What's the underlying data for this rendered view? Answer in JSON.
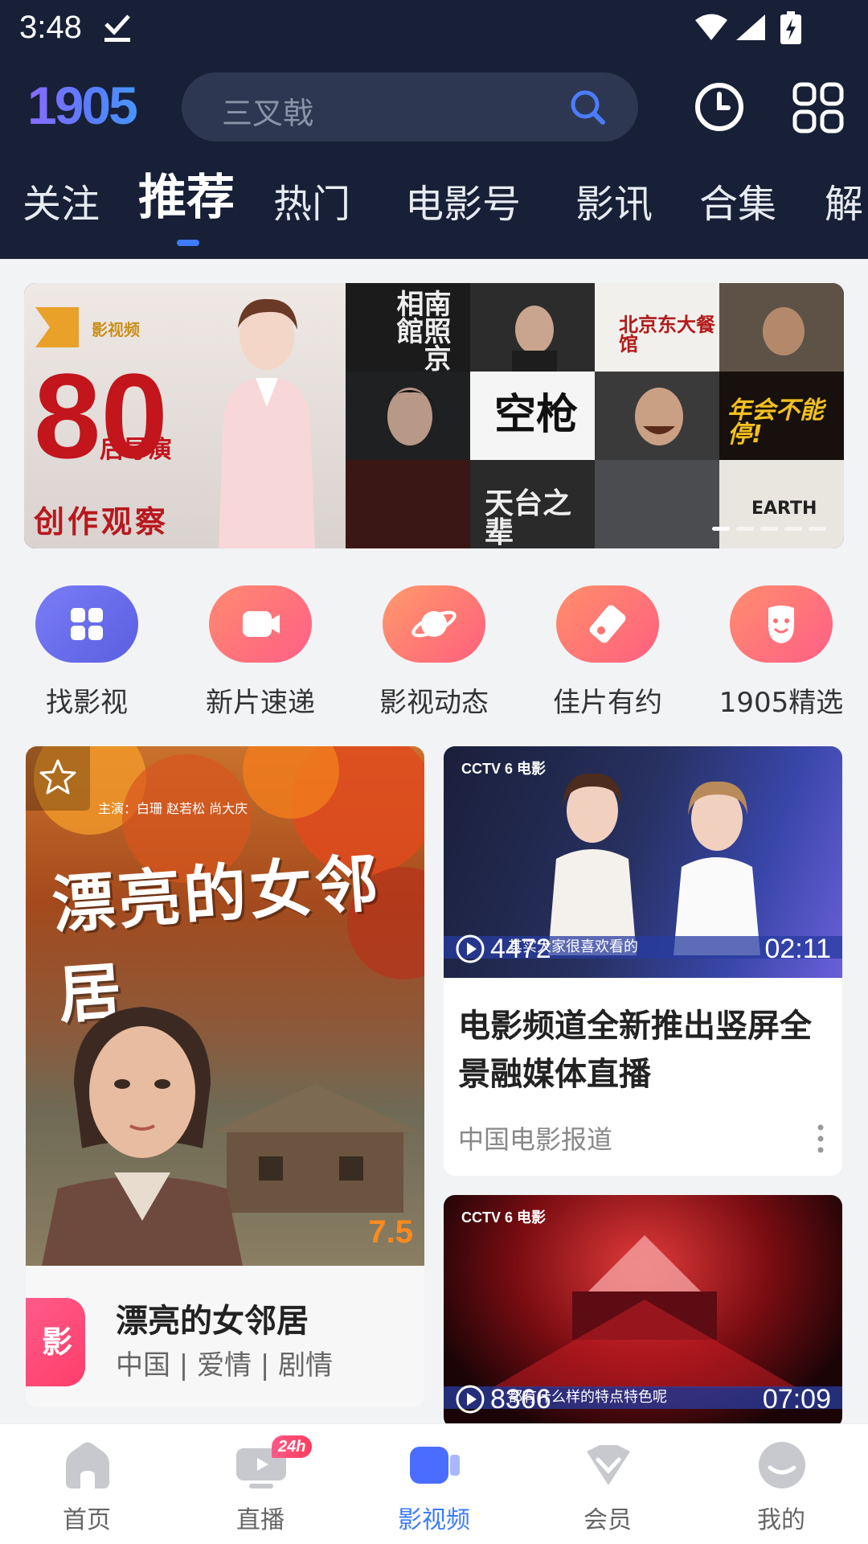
{
  "status": {
    "time": "3:48"
  },
  "header": {
    "logo_text": "1905",
    "search_placeholder": "三叉戟",
    "tabs": [
      "关注",
      "推荐",
      "热门",
      "电影号",
      "影讯",
      "合集",
      "解"
    ],
    "active_tab": "推荐"
  },
  "banner": {
    "tag": "影视频",
    "big_number": "80",
    "sub1": "后导演",
    "sub2": "创作观察",
    "posters": [
      "南照京相館",
      "空枪",
      "天台之辈",
      "年会不能停!"
    ],
    "dots": 5,
    "active_dot": 0
  },
  "quick_entries": [
    {
      "label": "找影视",
      "icon": "grid-icon",
      "color": "#6a6ff0"
    },
    {
      "label": "新片速递",
      "icon": "video-camera-icon",
      "color": "#ff6b7a"
    },
    {
      "label": "影视动态",
      "icon": "planet-icon",
      "color": "#ff7a6a"
    },
    {
      "label": "佳片有约",
      "icon": "ticket-icon",
      "color": "#ff7372"
    },
    {
      "label": "1905精选",
      "icon": "mask-icon",
      "color": "#ff6e78"
    }
  ],
  "movie_card": {
    "poster_title": "漂亮的女邻居",
    "cast_line": "主演：白珊  赵若松  尚大庆",
    "score": "7.5",
    "badge": "影",
    "title": "漂亮的女邻居",
    "meta": "中国 | 爱情 | 剧情"
  },
  "video_cards": [
    {
      "channel": "CCTV 6 电影",
      "caption": "其实大家很喜欢看的",
      "plays": "4472",
      "duration": "02:11",
      "title": "电影频道全新推出竖屏全景融媒体直播",
      "source": "中国电影报道"
    },
    {
      "channel": "CCTV 6 电影",
      "caption": "都有什么样的特点特色呢",
      "plays": "8366",
      "duration": "07:09"
    }
  ],
  "bottom_nav": {
    "items": [
      "首页",
      "直播",
      "影视频",
      "会员",
      "我的"
    ],
    "live_badge": "24h",
    "active": "影视频"
  },
  "colors": {
    "header_bg": "#172036",
    "accent": "#3d7bff",
    "score": "#ff8a1f"
  }
}
